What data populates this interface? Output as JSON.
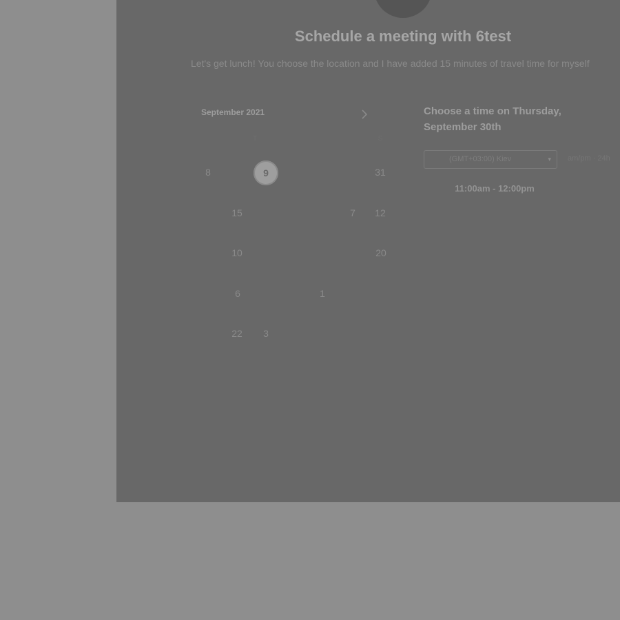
{
  "header": {
    "title": "Schedule a meeting with 6test",
    "description": "Let's get lunch! You choose the location and I have added 15 minutes of travel time for myself"
  },
  "calendar": {
    "month_label": "September 2021",
    "weekday_headers": [
      "T",
      "S"
    ],
    "days": [
      {
        "label": "8"
      },
      {
        "label": "9",
        "selected": true
      },
      {
        "label": "31"
      },
      {
        "label": "15"
      },
      {
        "label": "7"
      },
      {
        "label": "12"
      },
      {
        "label": "10"
      },
      {
        "label": "20"
      },
      {
        "label": "6"
      },
      {
        "label": "1"
      },
      {
        "label": "22"
      },
      {
        "label": "3"
      }
    ]
  },
  "time_picker": {
    "heading": "Choose a time on Thursday, September 30th",
    "timezone_value": "(GMT+03:00) Kiev",
    "format_am_pm": "am/pm",
    "format_separator": "·",
    "format_24h": "24h",
    "slots": [
      "11:00am - 12:00pm"
    ]
  },
  "colors": {
    "page_background": "#8e8e8e",
    "panel_background": "#686868"
  }
}
